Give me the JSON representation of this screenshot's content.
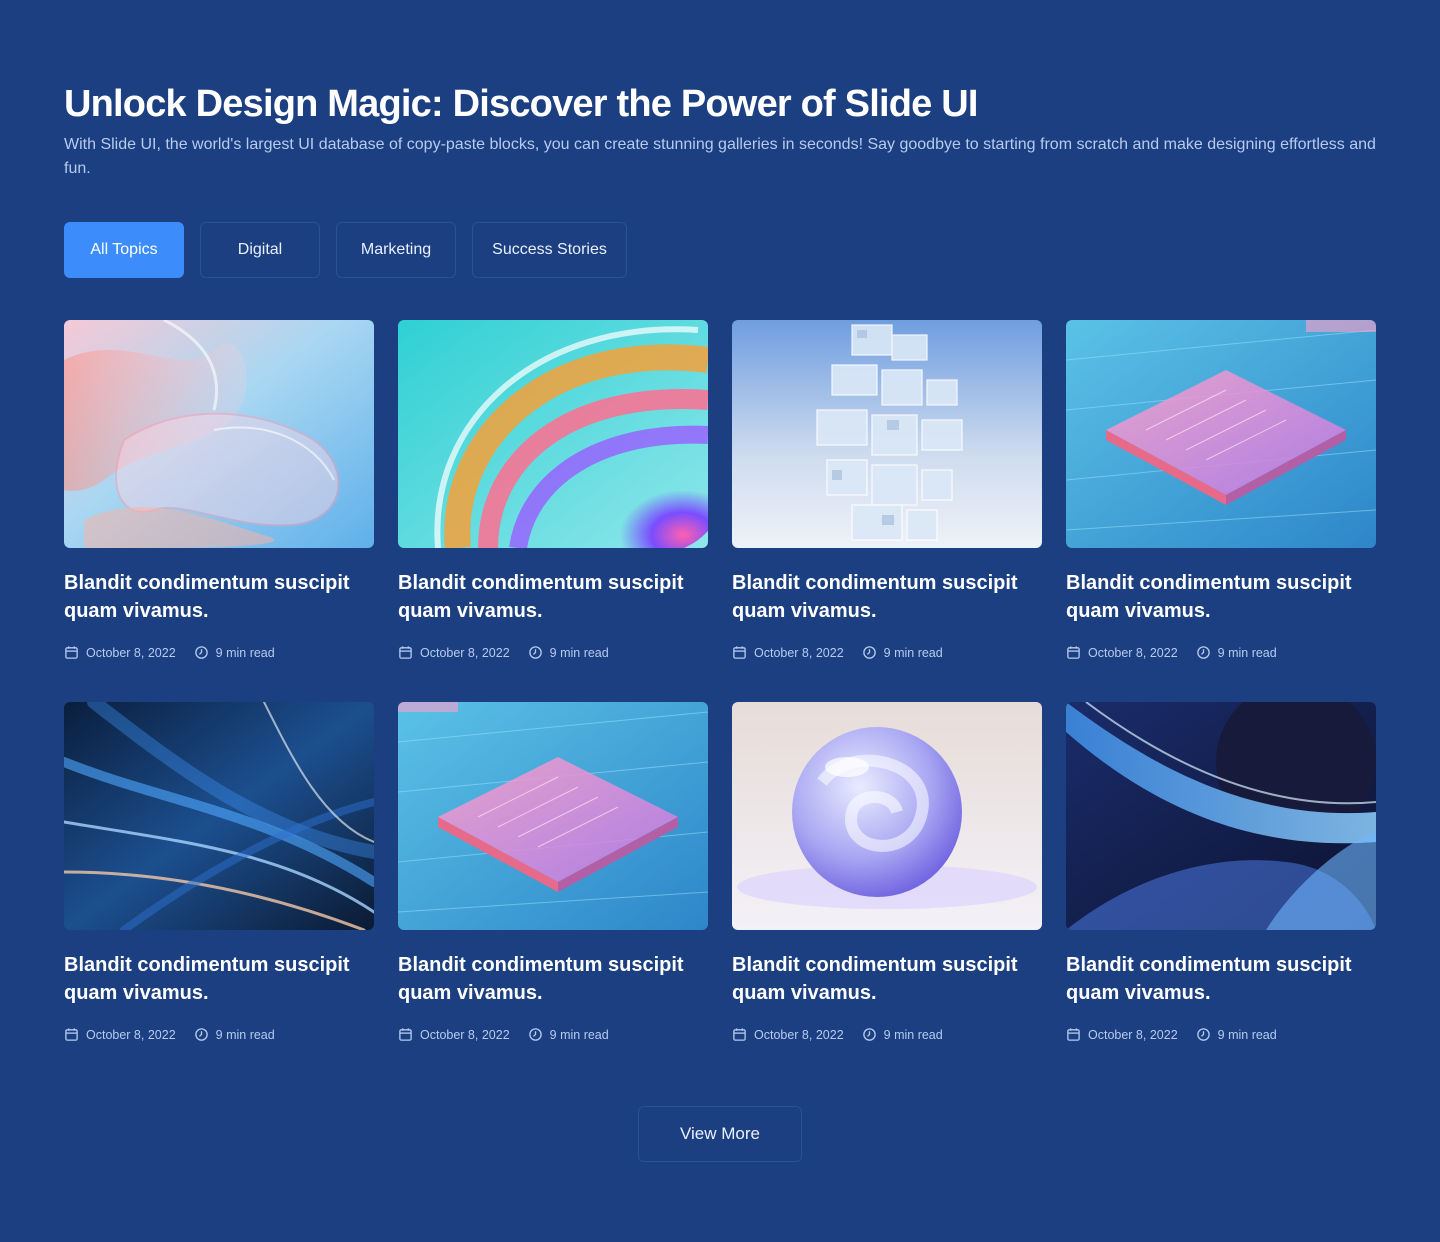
{
  "header": {
    "title": "Unlock Design Magic: Discover the Power of Slide UI",
    "subtitle": "With Slide UI, the world's largest UI database of copy-paste blocks, you can create stunning galleries in seconds! Say goodbye to starting from scratch and make designing effortless and fun."
  },
  "tabs": [
    {
      "label": "All Topics",
      "active": true
    },
    {
      "label": "Digital",
      "active": false
    },
    {
      "label": "Marketing",
      "active": false
    },
    {
      "label": "Success Stories",
      "active": false
    }
  ],
  "posts": [
    {
      "title": "Blandit condimentum suscipit quam vivamus.",
      "date": "October 8, 2022",
      "read_time": "9 min read",
      "image": "pink-glass-waves"
    },
    {
      "title": "Blandit condimentum suscipit quam vivamus.",
      "date": "October 8, 2022",
      "read_time": "9 min read",
      "image": "iridescent-swirl"
    },
    {
      "title": "Blandit condimentum suscipit quam vivamus.",
      "date": "October 8, 2022",
      "read_time": "9 min read",
      "image": "glass-cube-tower"
    },
    {
      "title": "Blandit condimentum suscipit quam vivamus.",
      "date": "October 8, 2022",
      "read_time": "9 min read",
      "image": "circuit-chip"
    },
    {
      "title": "Blandit condimentum suscipit quam vivamus.",
      "date": "October 8, 2022",
      "read_time": "9 min read",
      "image": "blue-light-streaks"
    },
    {
      "title": "Blandit condimentum suscipit quam vivamus.",
      "date": "October 8, 2022",
      "read_time": "9 min read",
      "image": "circuit-chip"
    },
    {
      "title": "Blandit condimentum suscipit quam vivamus.",
      "date": "October 8, 2022",
      "read_time": "9 min read",
      "image": "glass-sphere"
    },
    {
      "title": "Blandit condimentum suscipit quam vivamus.",
      "date": "October 8, 2022",
      "read_time": "9 min read",
      "image": "blue-ribbon-wave"
    }
  ],
  "view_more_label": "View More",
  "colors": {
    "background": "#1b3f80",
    "accent": "#3c8dfb",
    "muted_text": "#b7cbf0",
    "border": "#2b5196"
  },
  "icons": {
    "date": "calendar-icon",
    "read_time": "clock-icon"
  }
}
